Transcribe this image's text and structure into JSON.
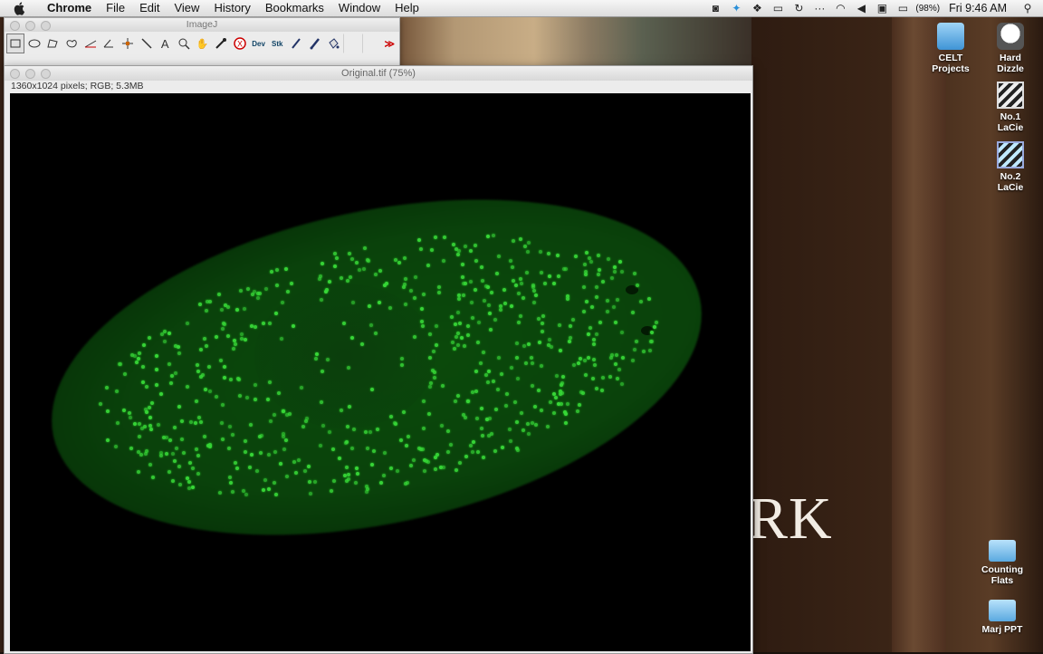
{
  "menubar": {
    "app_name": "Chrome",
    "items": [
      "File",
      "Edit",
      "View",
      "History",
      "Bookmarks",
      "Window",
      "Help"
    ],
    "battery": "(98%)",
    "clock": "Fri 9:46 AM"
  },
  "imagej": {
    "title": "ImageJ",
    "tools": [
      "rectangle",
      "oval",
      "polygon",
      "freehand",
      "straight-line",
      "angle",
      "point",
      "wand",
      "text",
      "magnifier",
      "scroll",
      "color-picker",
      "clear",
      "Dev",
      "Stk",
      "pencil",
      "brush",
      "flood-fill",
      "",
      ""
    ],
    "dev_label": "Dev",
    "stk_label": "Stk",
    "more_label": "≫"
  },
  "image_window": {
    "title": "Original.tif (75%)",
    "info": "1360x1024 pixels; RGB; 5.3MB"
  },
  "desktop": {
    "wallpaper_text": "RK",
    "icons": [
      {
        "label_1": "CELT",
        "label_2": "Projects"
      },
      {
        "label_1": "Hard",
        "label_2": "Dizzle"
      },
      {
        "label_1": "No.1",
        "label_2": "LaCie"
      },
      {
        "label_1": "No.2",
        "label_2": "LaCie"
      },
      {
        "label_1": "Counting",
        "label_2": "Flats"
      },
      {
        "label_1": "Marj PPT",
        "label_2": ""
      }
    ]
  },
  "colors": {
    "fluorescence": "#38d838",
    "cell_body": "#0b4a0b"
  }
}
